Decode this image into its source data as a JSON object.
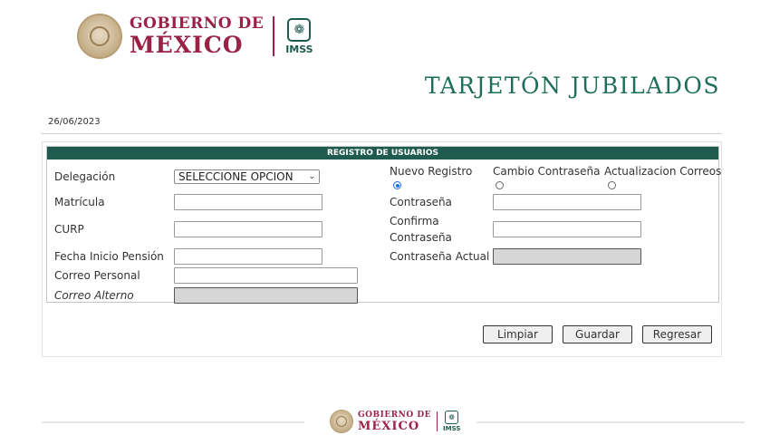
{
  "header": {
    "gob_line1": "GOBIERNO DE",
    "gob_line2": "MÉXICO",
    "imss_text": "IMSS",
    "imss_icon": "imss-eagle-icon",
    "seal_icon": "national-seal-icon"
  },
  "page": {
    "title": "TARJETÓN JUBILADOS",
    "date": "26/06/2023"
  },
  "form": {
    "section_title": "REGISTRO DE USUARIOS",
    "labels": {
      "delegacion": "Delegación",
      "matricula": "Matrícula",
      "curp": "CURP",
      "fecha_inicio": "Fecha Inicio Pensión",
      "correo_personal": "Correo Personal",
      "correo_alterno": "Correo Alterno",
      "contrasena": "Contraseña",
      "confirma_1": "Confirma",
      "confirma_2": "Contraseña",
      "contrasena_actual": "Contraseña Actual"
    },
    "delegacion_selected": "SELECCIONE OPCION",
    "radio_options": [
      {
        "label": "Nuevo Registro",
        "checked": true
      },
      {
        "label": "Cambio Contraseña",
        "checked": false
      },
      {
        "label": "Actualizacion Correos",
        "checked": false
      }
    ],
    "values": {
      "matricula": "",
      "curp": "",
      "fecha_inicio": "",
      "correo_personal": "",
      "correo_alterno": "",
      "contrasena": "",
      "confirma": "",
      "contrasena_actual": ""
    }
  },
  "buttons": {
    "limpiar": "Limpiar",
    "guardar": "Guardar",
    "regresar": "Regresar"
  },
  "colors": {
    "guinda": "#9b2247",
    "imss_green": "#1f5c4f",
    "title_green": "#1f6e59"
  }
}
